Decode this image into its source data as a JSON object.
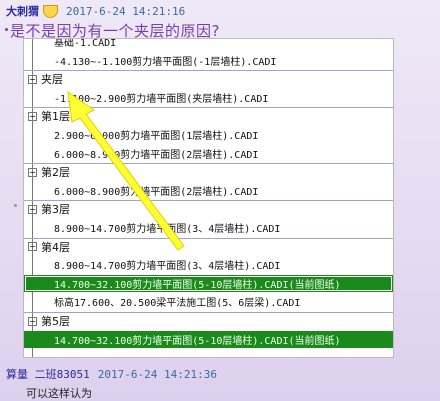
{
  "message": {
    "sender": "大刺猬",
    "timestamp": "2017-6-24 14:21:16",
    "text": "是不是因为有一个夹层的原因?"
  },
  "screenshot": {
    "rows": [
      {
        "kind": "file",
        "text": "基础-1.CADI",
        "partial": true
      },
      {
        "kind": "file",
        "text": "-4.130~-1.100剪力墙平面图(-1层墙柱).CADI"
      },
      {
        "kind": "group",
        "text": "夹层"
      },
      {
        "kind": "file",
        "text": "-1.100~2.900剪力墙平面图(夹层墙柱).CADI"
      },
      {
        "kind": "group",
        "text": "第1层"
      },
      {
        "kind": "file",
        "text": "2.900~6.000剪力墙平面图(1层墙柱).CADI"
      },
      {
        "kind": "file",
        "text": "6.000~8.900剪力墙平面图(2层墙柱).CADI"
      },
      {
        "kind": "group",
        "text": "第2层"
      },
      {
        "kind": "file",
        "text": "6.000~8.900剪力墙平面图(2层墙柱).CADI"
      },
      {
        "kind": "group",
        "text": "第3层"
      },
      {
        "kind": "file",
        "text": "8.900~14.700剪力墙平面图(3、4层墙柱).CADI"
      },
      {
        "kind": "group",
        "text": "第4层"
      },
      {
        "kind": "file",
        "text": "8.900~14.700剪力墙平面图(3、4层墙柱).CADI"
      },
      {
        "kind": "file",
        "text": "14.700~32.100剪力墙平面图(5-10层墙柱).CADI(当前图纸)",
        "highlight": true,
        "bordered": true
      },
      {
        "kind": "file",
        "text": "标高17.600、20.500梁平法施工图(5、6层梁).CADI"
      },
      {
        "kind": "group",
        "text": "第5层"
      },
      {
        "kind": "file",
        "text": "14.700~32.100剪力墙平面图(5-10层墙柱).CADI(当前图纸)",
        "highlight": true
      }
    ],
    "toggle_symbol": "−"
  },
  "reply": {
    "sender": "算量  二班83051",
    "timestamp": "2017-6-24 14:21:36",
    "text": "可以这样认为"
  },
  "colors": {
    "highlight": "#1a8a1a",
    "arrow": "#ffff33"
  }
}
